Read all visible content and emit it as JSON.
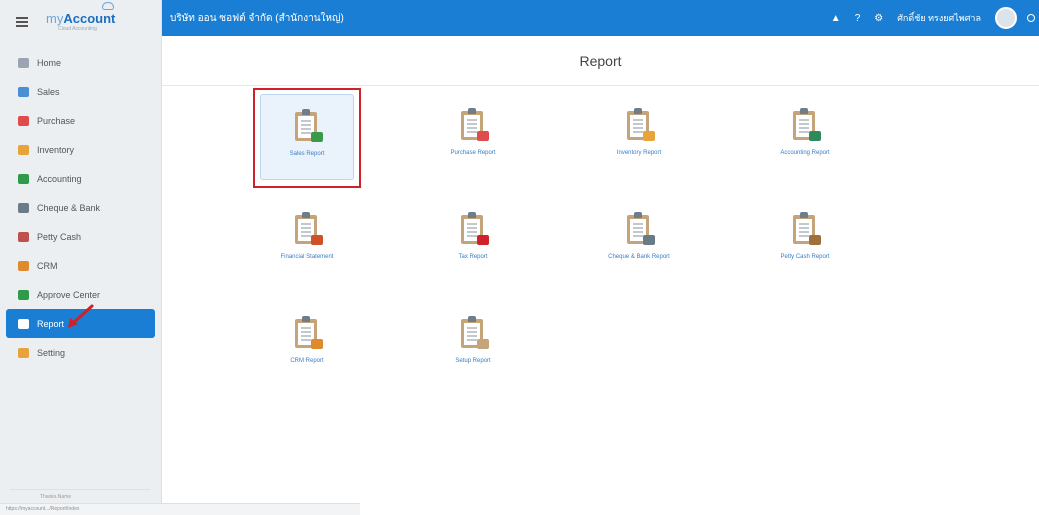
{
  "app": {
    "logo_text_my": "my",
    "logo_text_account": "Account",
    "logo_subtitle": "Cloud Accounting"
  },
  "sidebar": {
    "items": [
      {
        "label": "Home",
        "icon": "home-icon",
        "color": "#9aa5b1"
      },
      {
        "label": "Sales",
        "icon": "sales-icon",
        "color": "#4a8fd6"
      },
      {
        "label": "Purchase",
        "icon": "cart-icon",
        "color": "#e04b4b"
      },
      {
        "label": "Inventory",
        "icon": "box-icon",
        "color": "#e8a33a"
      },
      {
        "label": "Accounting",
        "icon": "book-icon",
        "color": "#2e9a4a"
      },
      {
        "label": "Cheque & Bank",
        "icon": "bank-icon",
        "color": "#6b7a88"
      },
      {
        "label": "Petty Cash",
        "icon": "cash-icon",
        "color": "#c0504d"
      },
      {
        "label": "CRM",
        "icon": "crm-icon",
        "color": "#e08a2e"
      },
      {
        "label": "Approve Center",
        "icon": "approve-icon",
        "color": "#2e9a4a"
      },
      {
        "label": "Report",
        "icon": "report-icon",
        "color": "#ffffff"
      },
      {
        "label": "Setting",
        "icon": "gear-icon",
        "color": "#e8a33a"
      }
    ],
    "active_index": 9,
    "bottom_text": "Thanks.Name",
    "status_url": "https://myaccount.../Report/Index"
  },
  "topbar": {
    "company": "บริษัท ออน ซอฟต์ จำกัด (สำนักงานใหญ่)",
    "bell_icon": "bell-icon",
    "help_label": "?",
    "user_name": "ศักดิ์ชัย ทรงยศไพศาล",
    "brand_color": "#1a7fd4"
  },
  "page": {
    "title": "Report"
  },
  "reports": [
    {
      "label": "Sales Report",
      "badge_color": "#3a9a4a",
      "selected": true
    },
    {
      "label": "Purchase Report",
      "badge_color": "#e04b4b",
      "selected": false
    },
    {
      "label": "Inventory Report",
      "badge_color": "#e8a33a",
      "selected": false
    },
    {
      "label": "Accounting Report",
      "badge_color": "#2e8a5a",
      "selected": false
    },
    {
      "label": "Financial Statement",
      "badge_color": "#d0502a",
      "selected": false
    },
    {
      "label": "Tax Report",
      "badge_color": "#d0202a",
      "selected": false
    },
    {
      "label": "Cheque & Bank Report",
      "badge_color": "#6b7a88",
      "selected": false
    },
    {
      "label": "Petty Cash Report",
      "badge_color": "#a0703a",
      "selected": false
    },
    {
      "label": "CRM Report",
      "badge_color": "#e08a2e",
      "selected": false
    },
    {
      "label": "Setup Report",
      "badge_color": "#c6a47a",
      "selected": false
    }
  ]
}
